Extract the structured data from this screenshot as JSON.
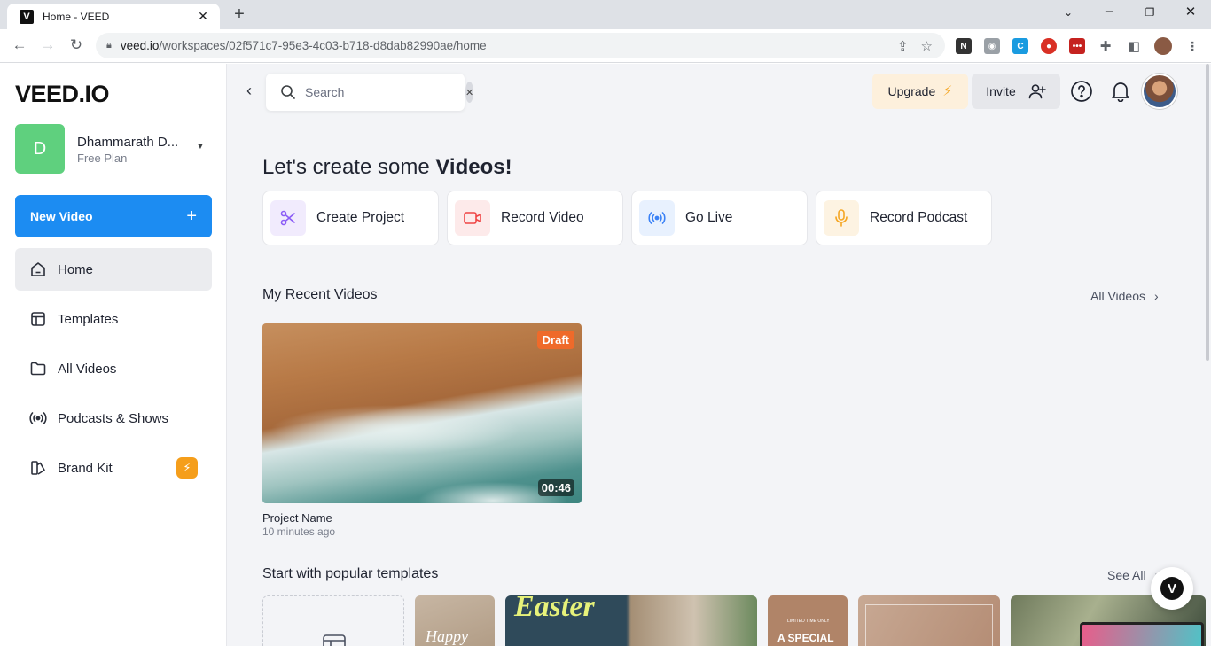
{
  "browser": {
    "tab_title": "Home - VEED",
    "favicon_letter": "V",
    "url_host": "veed.io",
    "url_path": "/workspaces/02f571c7-95e3-4c03-b718-d8dab82990ae/home"
  },
  "sidebar": {
    "logo": "VEED.IO",
    "workspace": {
      "initial": "D",
      "name": "Dhammarath D...",
      "plan": "Free Plan"
    },
    "new_video_label": "New Video",
    "items": [
      {
        "label": "Home",
        "icon": "home-icon",
        "active": true
      },
      {
        "label": "Templates",
        "icon": "templates-icon"
      },
      {
        "label": "All Videos",
        "icon": "folder-icon"
      },
      {
        "label": "Podcasts & Shows",
        "icon": "broadcast-icon"
      },
      {
        "label": "Brand Kit",
        "icon": "brand-kit-icon",
        "badge": "bolt-icon"
      }
    ]
  },
  "header": {
    "search_placeholder": "Search",
    "upgrade_label": "Upgrade",
    "invite_label": "Invite"
  },
  "main": {
    "headline_prefix": "Let's create some ",
    "headline_bold": "Videos!",
    "quick_actions": [
      {
        "label": "Create Project",
        "icon": "scissors-icon",
        "color": "#8b5cf6",
        "bg": "#f1ebfd"
      },
      {
        "label": "Record Video",
        "icon": "camera-icon",
        "color": "#ef4444",
        "bg": "#fdeaea"
      },
      {
        "label": "Go Live",
        "icon": "broadcast-icon",
        "color": "#3b82f6",
        "bg": "#e8f1fe"
      },
      {
        "label": "Record Podcast",
        "icon": "microphone-icon",
        "color": "#f5a623",
        "bg": "#fdf3e2"
      }
    ],
    "recent": {
      "title": "My Recent Videos",
      "link": "All Videos",
      "videos": [
        {
          "badge": "Draft",
          "duration": "00:46",
          "name": "Project Name",
          "time": "10 minutes ago"
        }
      ]
    },
    "templates": {
      "title": "Start with popular templates",
      "link": "See All",
      "items": [
        {
          "text": ""
        },
        {
          "text": "Happy"
        },
        {
          "text": "Easter"
        },
        {
          "text": "LIMITED TIME ONLY",
          "text2": "A SPECIAL"
        },
        {
          "text": ""
        },
        {
          "text": ""
        }
      ]
    }
  }
}
